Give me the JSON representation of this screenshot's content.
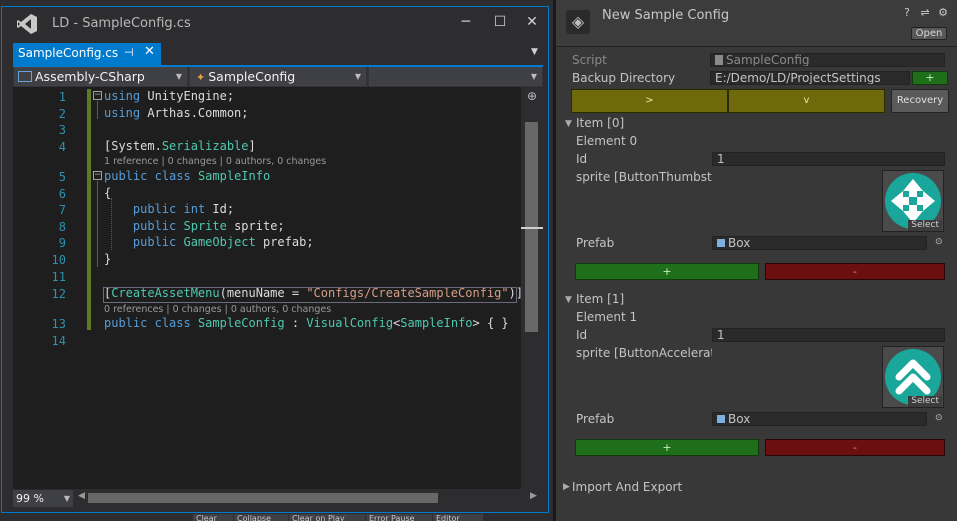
{
  "vs": {
    "window_title": "LD - SampleConfig.cs",
    "tab": {
      "label": "SampleConfig.cs",
      "pin": "⊣",
      "close": "✕"
    },
    "window_buttons": {
      "minimize": "─",
      "maximize": "☐",
      "close": "✕"
    },
    "nav": {
      "project": "Assembly-CSharp",
      "type": "SampleConfig",
      "member": ""
    },
    "zoom": "99 %",
    "code_lines": [
      {
        "num": "1",
        "tokens": [
          {
            "c": "kw",
            "t": "using"
          },
          {
            "c": "",
            "t": " UnityEngine;"
          }
        ]
      },
      {
        "num": "2",
        "tokens": [
          {
            "c": "kw",
            "t": "using"
          },
          {
            "c": "",
            "t": " Arthas.Common;"
          }
        ]
      },
      {
        "num": "3",
        "tokens": []
      },
      {
        "num": "4",
        "tokens": [
          {
            "c": "",
            "t": "["
          },
          {
            "c": "",
            "t": "System."
          },
          {
            "c": "ty",
            "t": "Serializable"
          },
          {
            "c": "",
            "t": "]"
          }
        ]
      },
      {
        "num": "5",
        "tokens": [
          {
            "c": "kw",
            "t": "public"
          },
          {
            "c": "",
            "t": " "
          },
          {
            "c": "kw",
            "t": "class"
          },
          {
            "c": "",
            "t": " "
          },
          {
            "c": "ty",
            "t": "SampleInfo"
          }
        ]
      },
      {
        "num": "6",
        "tokens": [
          {
            "c": "",
            "t": "{"
          }
        ]
      },
      {
        "num": "7",
        "tokens": [
          {
            "c": "",
            "t": "    "
          },
          {
            "c": "kw",
            "t": "public"
          },
          {
            "c": "",
            "t": " "
          },
          {
            "c": "kw",
            "t": "int"
          },
          {
            "c": "",
            "t": " Id;"
          }
        ]
      },
      {
        "num": "8",
        "tokens": [
          {
            "c": "",
            "t": "    "
          },
          {
            "c": "kw",
            "t": "public"
          },
          {
            "c": "",
            "t": " "
          },
          {
            "c": "ty",
            "t": "Sprite"
          },
          {
            "c": "",
            "t": " sprite;"
          }
        ]
      },
      {
        "num": "9",
        "tokens": [
          {
            "c": "",
            "t": "    "
          },
          {
            "c": "kw",
            "t": "public"
          },
          {
            "c": "",
            "t": " "
          },
          {
            "c": "ty",
            "t": "GameObject"
          },
          {
            "c": "",
            "t": " prefab;"
          }
        ]
      },
      {
        "num": "10",
        "tokens": [
          {
            "c": "",
            "t": "}"
          }
        ]
      },
      {
        "num": "11",
        "tokens": []
      },
      {
        "num": "12",
        "tokens": [
          {
            "c": "",
            "t": "["
          },
          {
            "c": "ty",
            "t": "CreateAssetMenu"
          },
          {
            "c": "",
            "t": "(menuName = "
          },
          {
            "c": "st",
            "t": "\"Configs/CreateSampleConfig\""
          },
          {
            "c": "",
            "t": ")]"
          }
        ]
      },
      {
        "num": "13",
        "tokens": [
          {
            "c": "kw",
            "t": "public"
          },
          {
            "c": "",
            "t": " "
          },
          {
            "c": "kw",
            "t": "class"
          },
          {
            "c": "",
            "t": " "
          },
          {
            "c": "ty",
            "t": "SampleConfig"
          },
          {
            "c": "",
            "t": " : "
          },
          {
            "c": "ty",
            "t": "VisualConfig"
          },
          {
            "c": "",
            "t": "<"
          },
          {
            "c": "ty",
            "t": "SampleInfo"
          },
          {
            "c": "",
            "t": "> { }"
          }
        ]
      },
      {
        "num": "14",
        "tokens": []
      }
    ],
    "codelens": {
      "serializable": "1 reference | 0 changes | 0 authors, 0 changes",
      "sampleconfig": "0 references | 0 changes | 0 authors, 0 changes"
    },
    "taskbar": [
      "Clear",
      "Collapse",
      "Clear on Play",
      "Error Pause",
      "Editor"
    ],
    "colors": {
      "accent": "#007acc",
      "keyword": "#569cd6",
      "type": "#4ec9b0",
      "string": "#d69d85",
      "line_number": "#2b91af"
    }
  },
  "unity": {
    "title": "New Sample Config",
    "open_button": "Open",
    "script_label": "Script",
    "script_value": "SampleConfig",
    "backup_label": "Backup Directory",
    "backup_value": "E:/Demo/LD/ProjectSettings",
    "add_label": "+",
    "expand_label": ">",
    "collapse_label": "v",
    "recovery_label": "Recovery",
    "items": [
      {
        "header": "Item [0]",
        "element": "Element 0",
        "id_label": "Id",
        "id_value": "1",
        "sprite_label": "sprite [ButtonThumbstic",
        "sprite_icon": "move-arrows-icon",
        "select_label": "Select",
        "prefab_label": "Prefab",
        "prefab_value": "Box",
        "add": "+",
        "remove": "-"
      },
      {
        "header": "Item [1]",
        "element": "Element 1",
        "id_label": "Id",
        "id_value": "1",
        "sprite_label": "sprite [ButtonAccelerato",
        "sprite_icon": "double-chevron-up-icon",
        "select_label": "Select",
        "prefab_label": "Prefab",
        "prefab_value": "Box",
        "add": "+",
        "remove": "-"
      }
    ],
    "import_export": "Import And Export",
    "colors": {
      "green_button": "#1e6e1a",
      "red_button": "#6a1010",
      "yellow_button": "#6e6a0c",
      "sprite_bg": "#1aa69a"
    }
  }
}
